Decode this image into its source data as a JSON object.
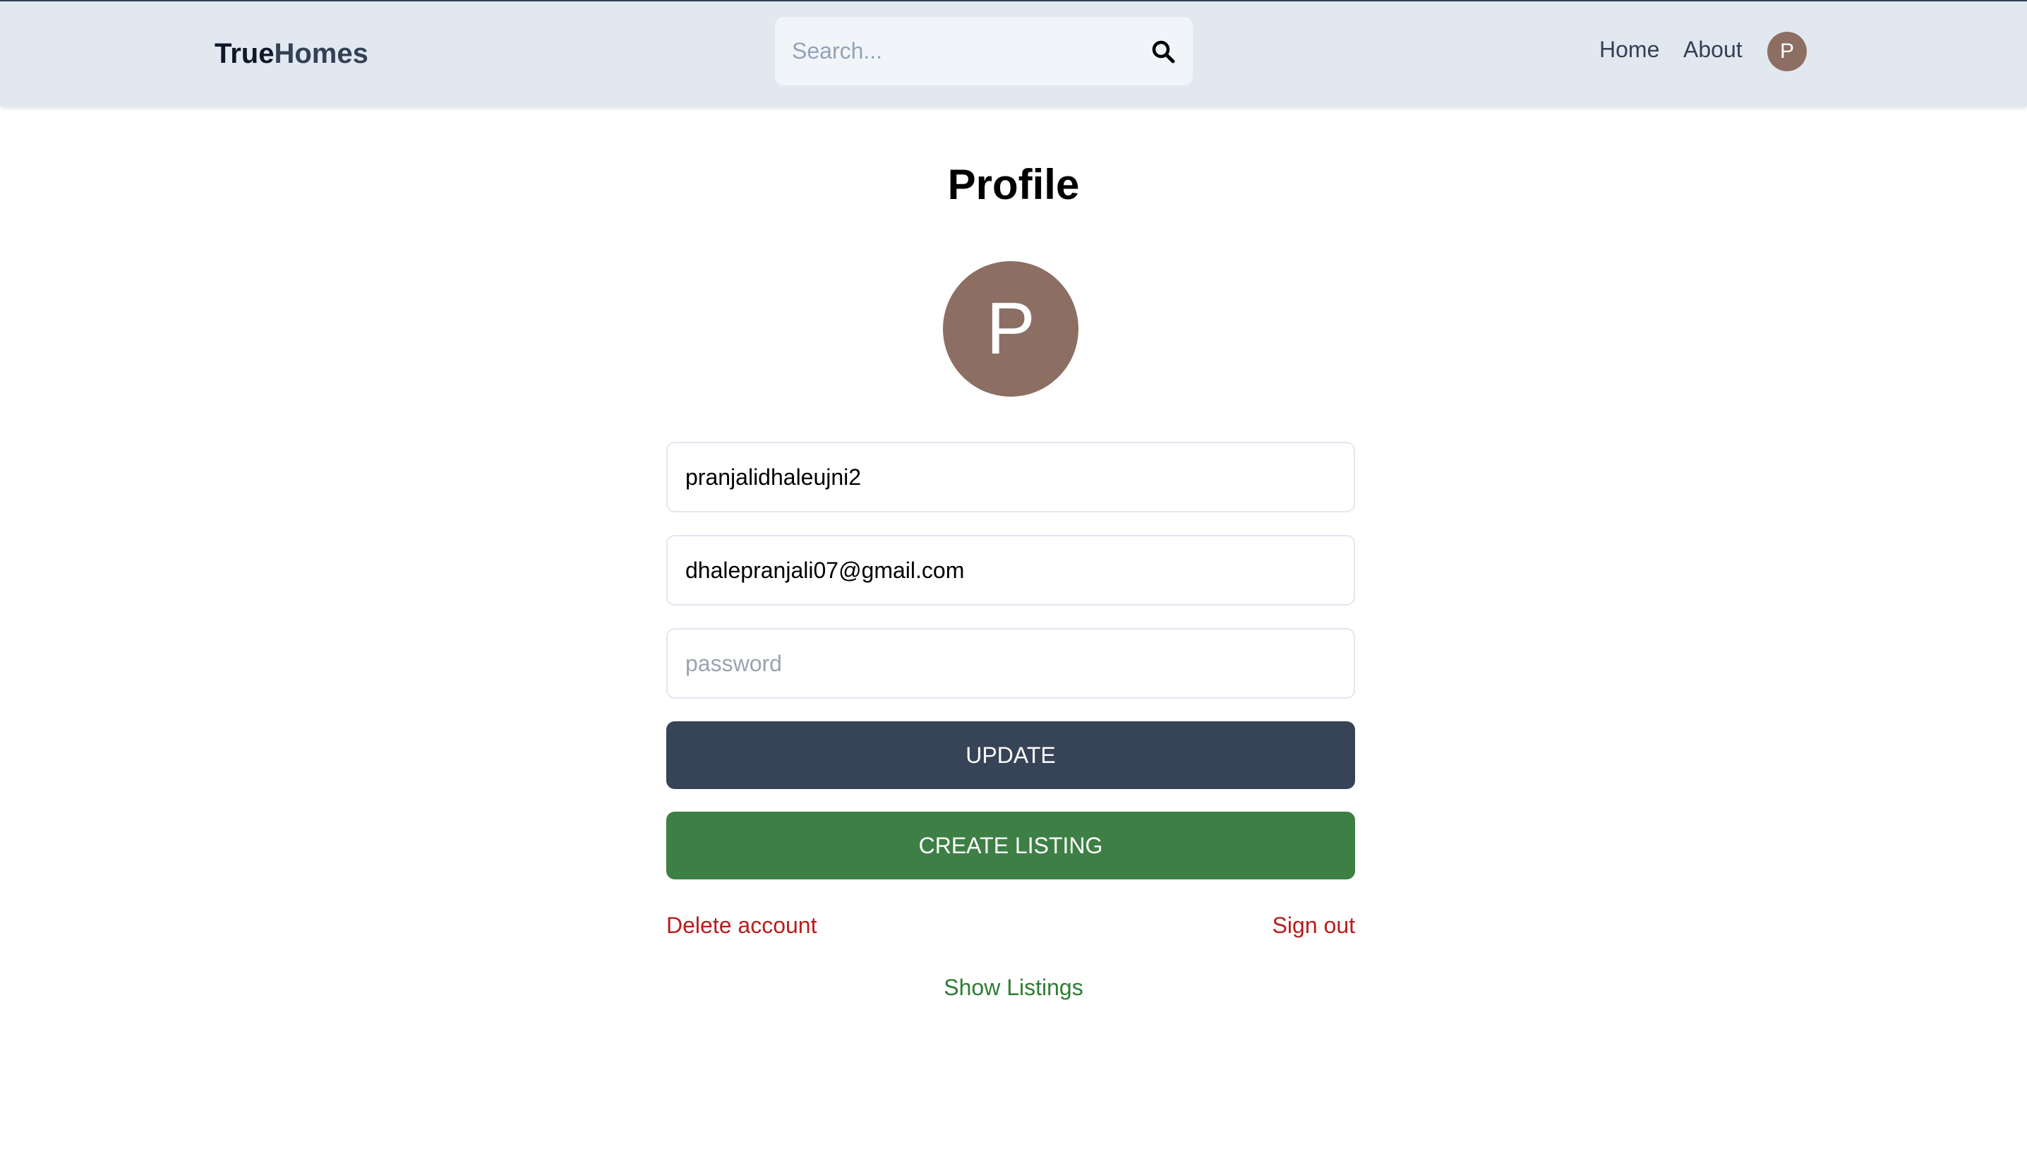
{
  "header": {
    "logo_part1": "True",
    "logo_part2": "Homes",
    "search_placeholder": "Search...",
    "search_icon": "search-icon",
    "nav": {
      "home": "Home",
      "about": "About"
    },
    "avatar_initial": "P"
  },
  "profile": {
    "title": "Profile",
    "avatar_initial": "P",
    "username": "pranjalidhaleujni2",
    "email": "dhalepranjali07@gmail.com",
    "password_placeholder": "password",
    "update_label": "UPDATE",
    "create_listing_label": "CREATE LISTING",
    "delete_account_label": "Delete account",
    "sign_out_label": "Sign out",
    "show_listings_label": "Show Listings"
  },
  "colors": {
    "header_bg": "#e2e8f0",
    "avatar_bg": "#8d6e63",
    "update_button": "#374357",
    "create_button": "#3e7f45",
    "danger_text": "#b91c1c",
    "success_text": "#2e7d32"
  }
}
